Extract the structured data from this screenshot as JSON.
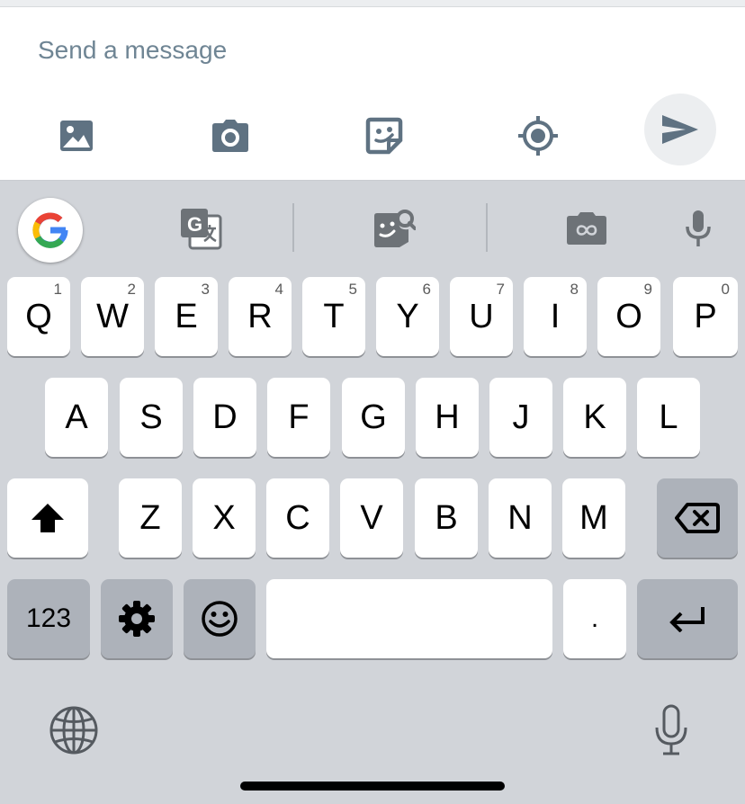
{
  "composer": {
    "placeholder": "Send a message",
    "tools": [
      "image-icon",
      "camera-icon",
      "sticker-icon",
      "location-icon"
    ],
    "send_icon": "send-icon"
  },
  "suggestion_strip": {
    "items": [
      "google-search-icon",
      "translate-icon",
      "sticker-search-icon",
      "gif-camera-icon",
      "microphone-icon"
    ]
  },
  "keyboard": {
    "row1": [
      {
        "letter": "Q",
        "num": "1"
      },
      {
        "letter": "W",
        "num": "2"
      },
      {
        "letter": "E",
        "num": "3"
      },
      {
        "letter": "R",
        "num": "4"
      },
      {
        "letter": "T",
        "num": "5"
      },
      {
        "letter": "Y",
        "num": "6"
      },
      {
        "letter": "U",
        "num": "7"
      },
      {
        "letter": "I",
        "num": "8"
      },
      {
        "letter": "O",
        "num": "9"
      },
      {
        "letter": "P",
        "num": "0"
      }
    ],
    "row2": [
      "A",
      "S",
      "D",
      "F",
      "G",
      "H",
      "J",
      "K",
      "L"
    ],
    "row3": [
      "Z",
      "X",
      "C",
      "V",
      "B",
      "N",
      "M"
    ],
    "numbers_label": "123",
    "period_label": ".",
    "shift_icon": "shift-icon",
    "backspace_icon": "backspace-icon",
    "settings_icon": "gear-icon",
    "emoji_icon": "emoji-icon",
    "enter_icon": "enter-icon",
    "globe_icon": "globe-icon",
    "dictation_icon": "microphone-icon"
  },
  "colors": {
    "keyboard_bg": "#d1d4d9",
    "key_light": "#ffffff",
    "key_dark": "#adb2ba",
    "icon_slate": "#5f7282",
    "icon_gray": "#6d7277"
  }
}
